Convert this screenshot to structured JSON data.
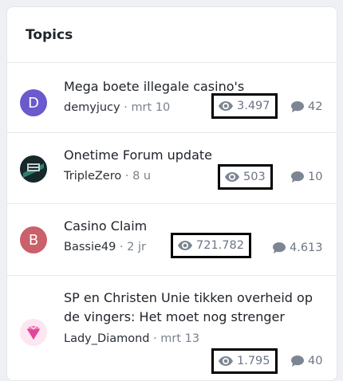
{
  "header": {
    "title": "Topics"
  },
  "topics": [
    {
      "title": "Mega boete illegale casino's",
      "author": "demyjucy",
      "time": "mrt 10",
      "views": "3.497",
      "replies": "42",
      "avatar": {
        "type": "letter",
        "letter": "D",
        "color": "#6a5acd"
      }
    },
    {
      "title": "Onetime Forum update",
      "author": "TripleZero",
      "time": "8 u",
      "views": "503",
      "replies": "10",
      "avatar": {
        "type": "image",
        "label": "TRIPLE ZERO"
      }
    },
    {
      "title": "Casino Claim",
      "author": "Bassie49",
      "time": "2 jr",
      "views": "721.782",
      "replies": "4.613",
      "avatar": {
        "type": "letter",
        "letter": "B",
        "color": "#c9606a"
      }
    },
    {
      "title": "SP en Christen Unie tikken overheid op de vingers: Het moet nog strenger",
      "author": "Lady_Diamond",
      "time": "mrt 13",
      "views": "1.795",
      "replies": "40",
      "avatar": {
        "type": "image",
        "label": "diamond"
      }
    }
  ],
  "separator": "·",
  "colors": {
    "accent_border": "#000000",
    "muted": "#6b7685"
  }
}
